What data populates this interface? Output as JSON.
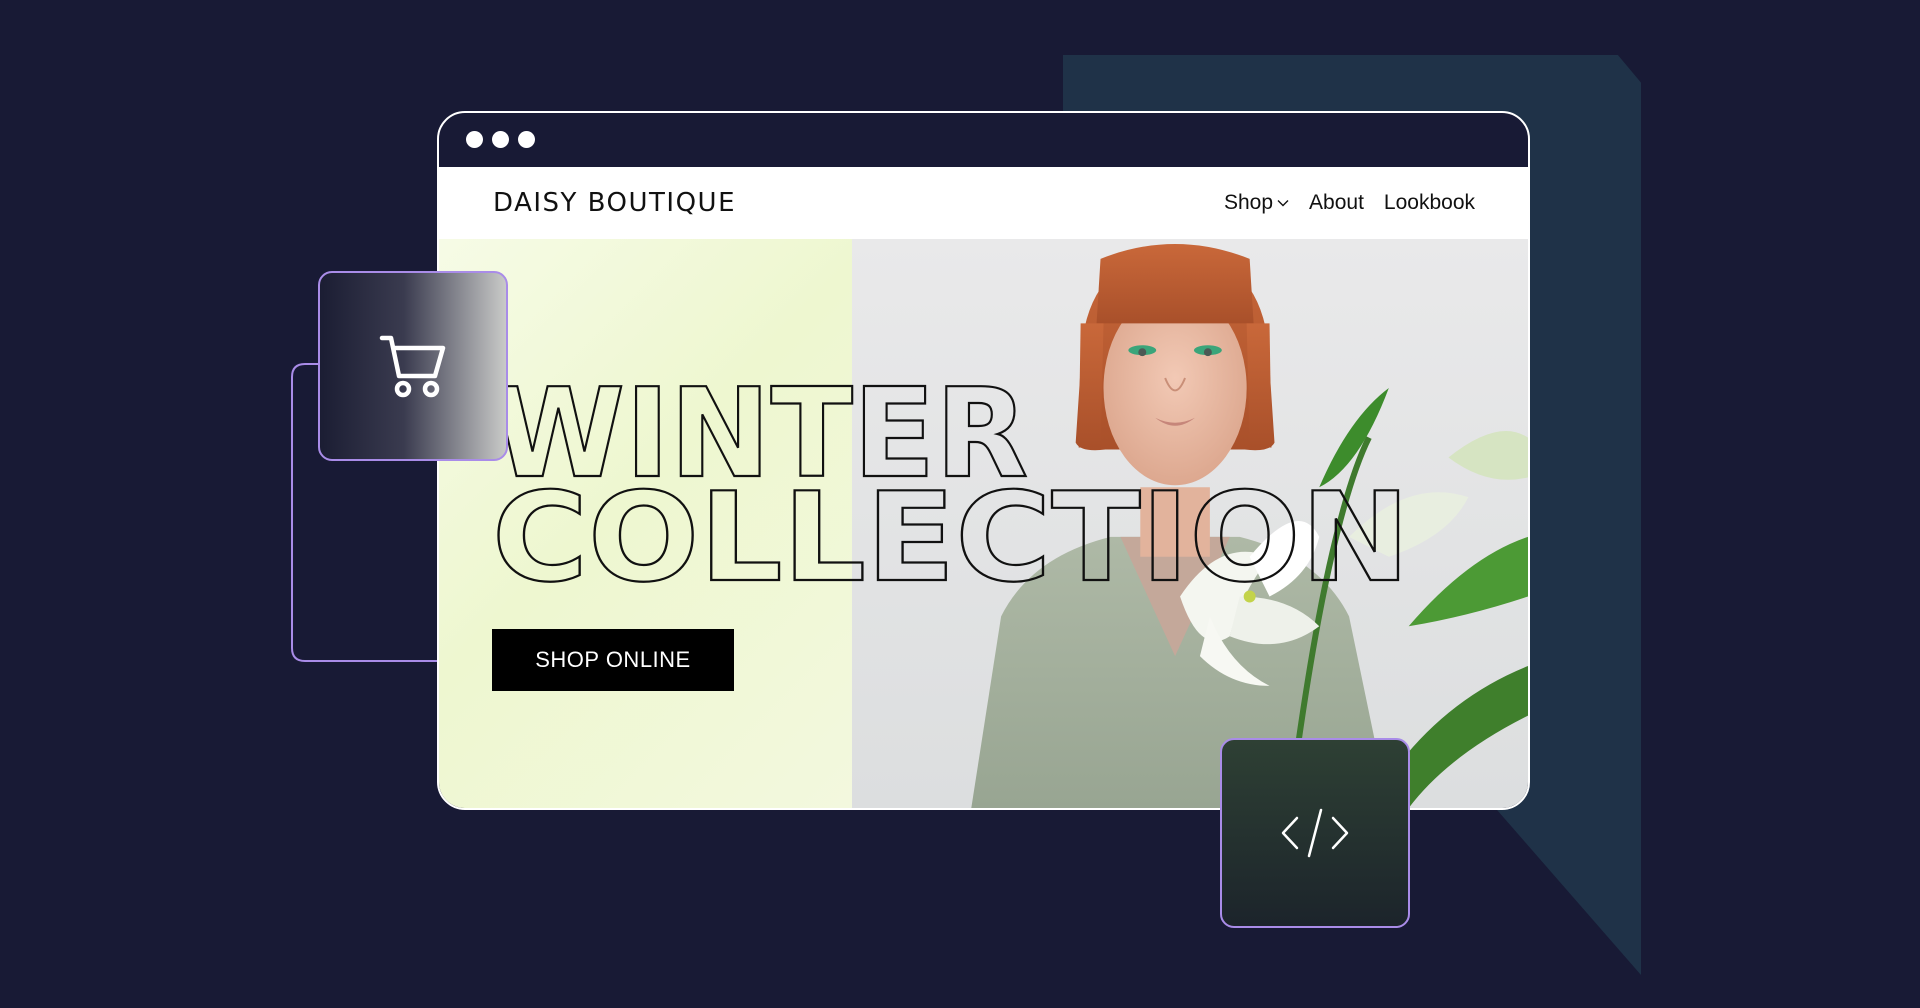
{
  "brand": {
    "name": "DAISY BOUTIQUE"
  },
  "nav": {
    "items": [
      {
        "label": "Shop",
        "icon": "chevron-down-icon"
      },
      {
        "label": "About"
      },
      {
        "label": "Lookbook"
      }
    ]
  },
  "hero": {
    "headline_line1": "WINTER",
    "headline_line2": "COLLECTION",
    "cta_label": "SHOP ONLINE"
  },
  "cards": {
    "cart": {
      "icon": "cart-icon"
    },
    "code": {
      "icon": "code-icon"
    }
  },
  "colors": {
    "page_background": "#181a35",
    "accent_shape": "#1f3248",
    "card_border": "#a98ce8",
    "cta_background": "#000000"
  }
}
